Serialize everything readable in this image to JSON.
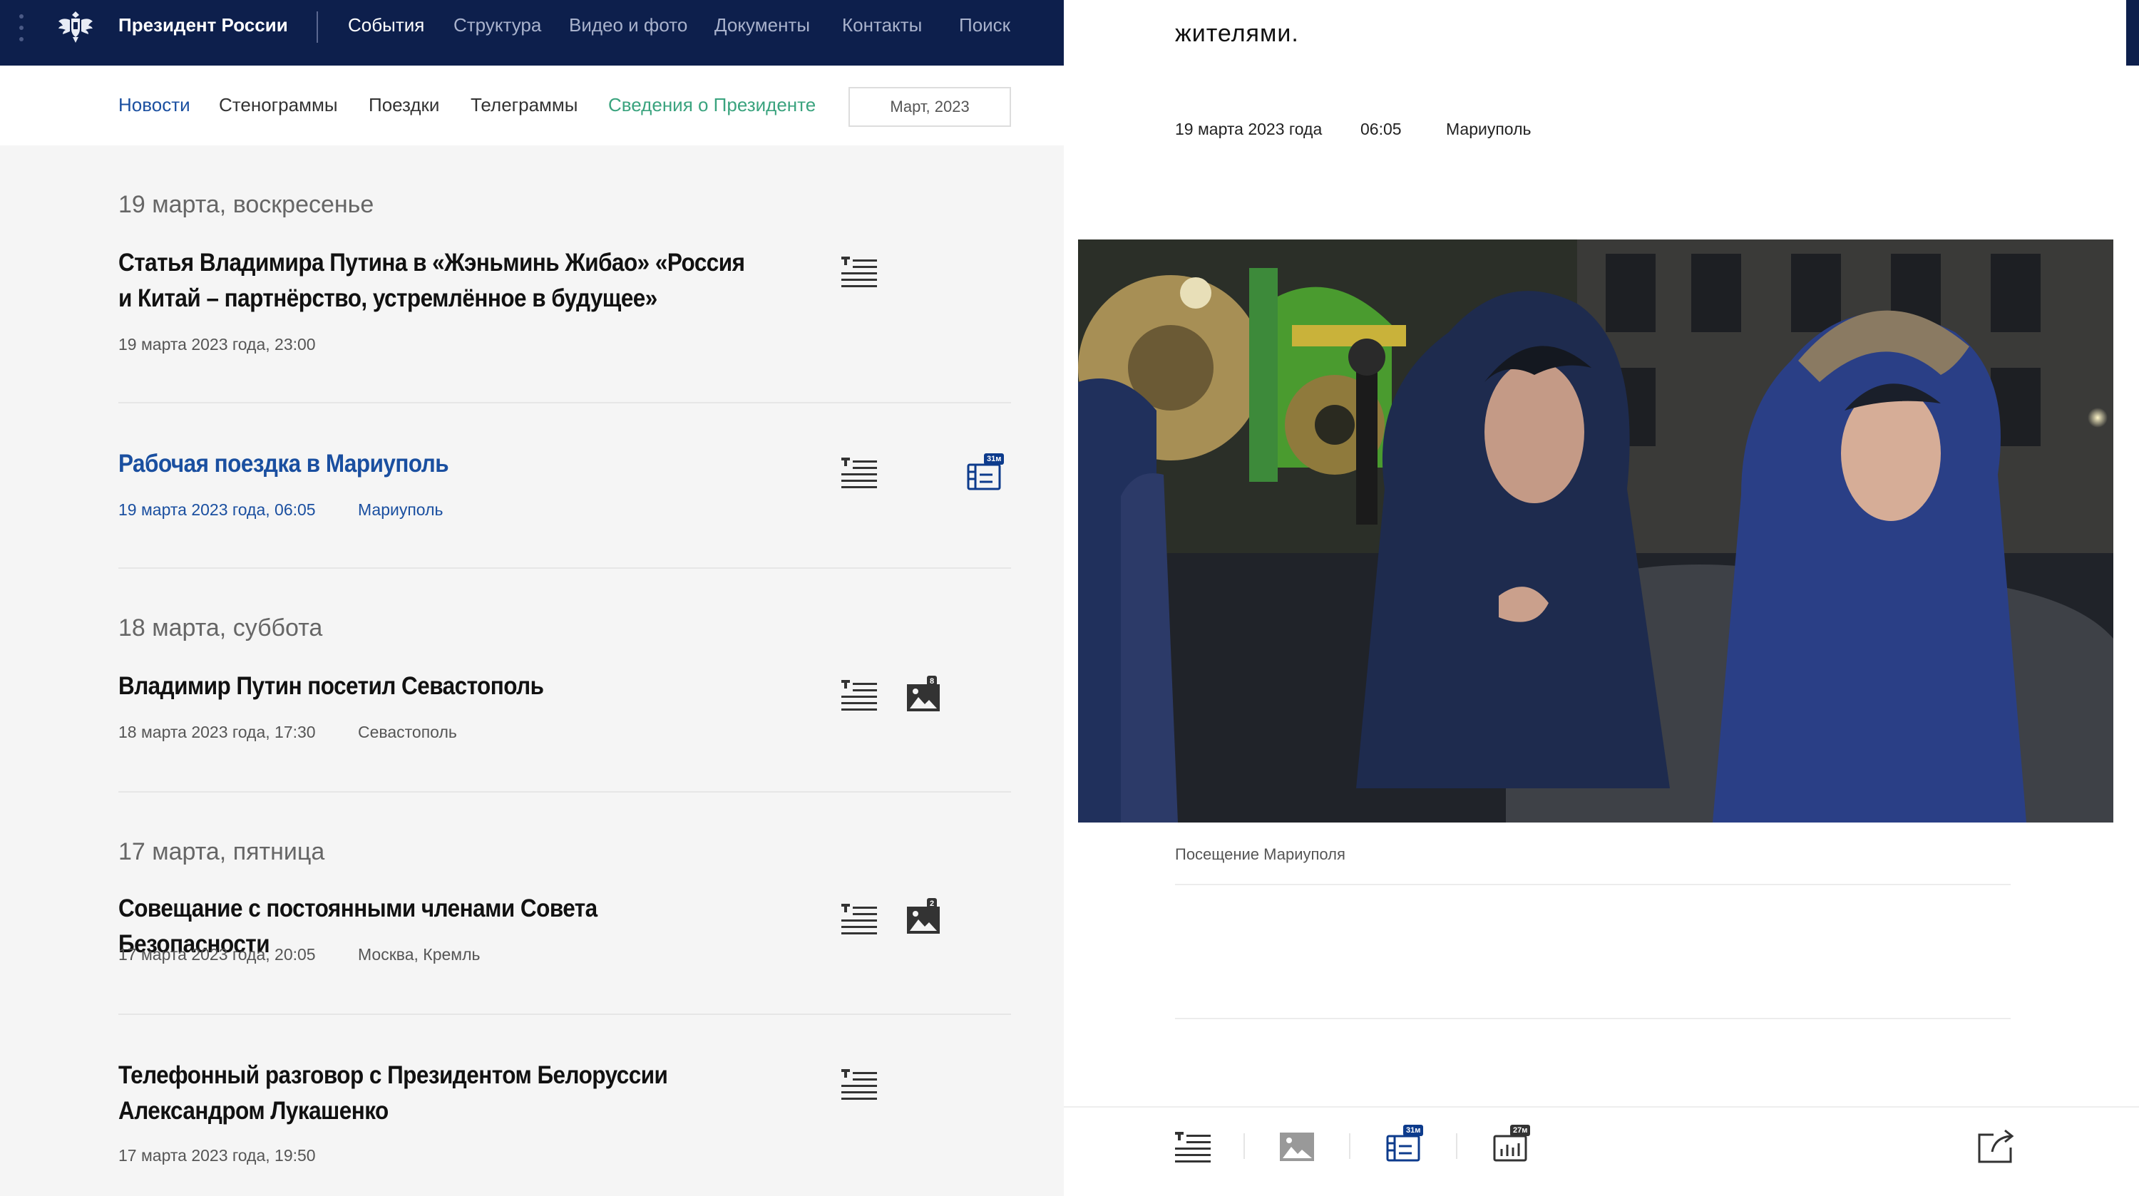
{
  "header": {
    "site_title": "Президент России",
    "nav": [
      "События",
      "Структура",
      "Видео и фото",
      "Документы",
      "Контакты",
      "Поиск"
    ]
  },
  "subnav": {
    "items": [
      "Новости",
      "Стенограммы",
      "Поездки",
      "Телеграммы",
      "Сведения о Президенте"
    ],
    "date_select": "Март, 2023"
  },
  "feed": {
    "days": [
      {
        "heading": "19 марта, воскресенье"
      },
      {
        "heading": "18 марта, суббота"
      },
      {
        "heading": "17 марта, пятница"
      }
    ],
    "items": [
      {
        "title": "Статья Владимира Путина в «Жэньминь Жибао» «Россия и Китай – партнёрство, устремлённое в будущее»",
        "datetime": "19 марта 2023 года, 23:00",
        "place": ""
      },
      {
        "title": "Рабочая поездка в Мариуполь",
        "datetime": "19 марта 2023 года, 06:05",
        "place": "Мариуполь",
        "video_badge": "31м"
      },
      {
        "title": "Владимир Путин посетил Севастополь",
        "datetime": "18 марта 2023 года, 17:30",
        "place": "Севастополь",
        "photo_badge": "8"
      },
      {
        "title": "Совещание с постоянными членами Совета Безопасности",
        "datetime": "17 марта 2023 года, 20:05",
        "place": "Москва, Кремль",
        "photo_badge": "2"
      },
      {
        "title": "Телефонный разговор с Президентом Белоруссии Александром Лукашенко",
        "datetime": "17 марта 2023 года, 19:50",
        "place": ""
      }
    ]
  },
  "article": {
    "text_fragment": "жителями.",
    "date": "19 марта 2023 года",
    "time": "06:05",
    "place": "Мариуполь",
    "photo_caption": "Посещение Мариуполя",
    "toolbar": {
      "video_badge": "31м",
      "audio_badge": "27м"
    }
  },
  "colors": {
    "header_bg": "#0d1f4c",
    "link": "#1a4fa0",
    "accent_green": "#3aa37e",
    "badge_bg": "#0d3b8c"
  }
}
